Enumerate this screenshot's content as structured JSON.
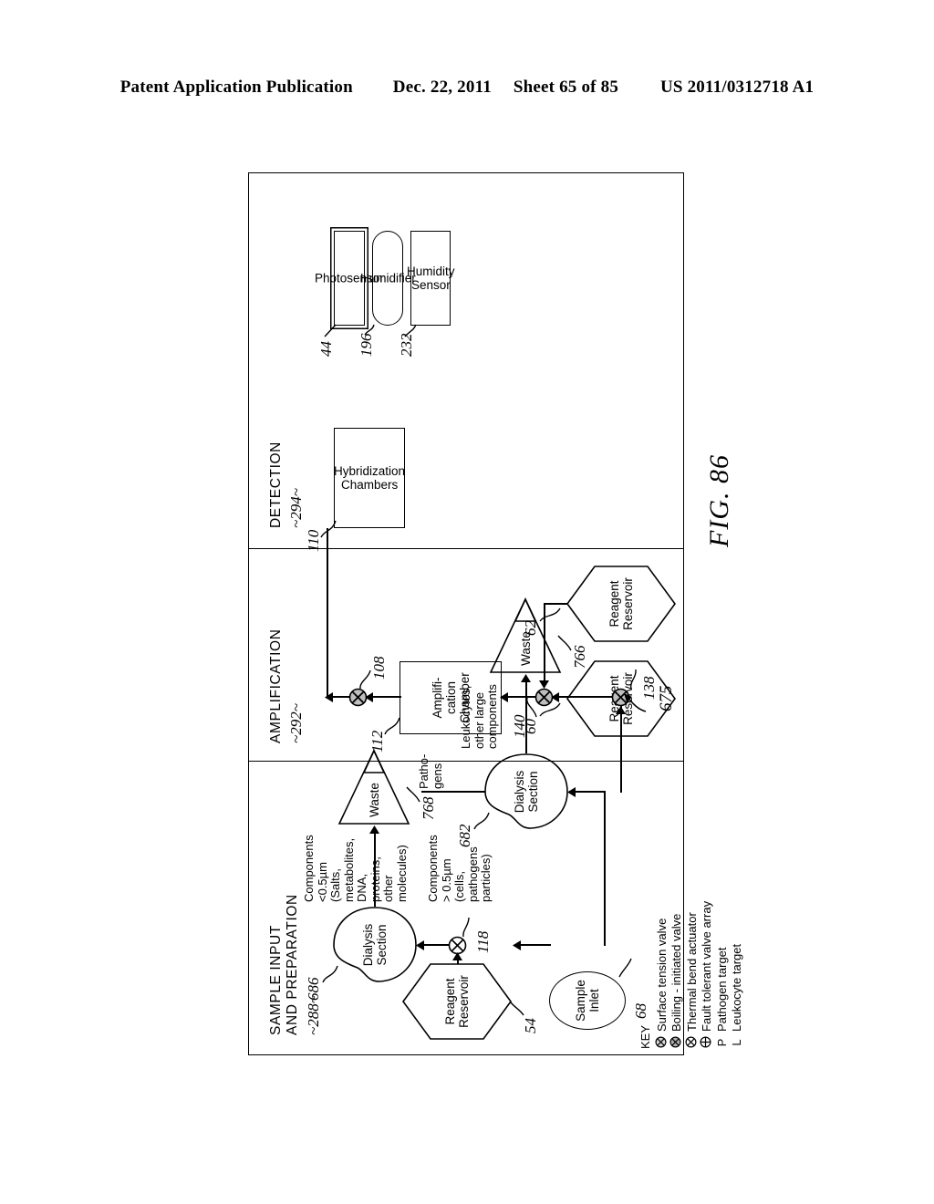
{
  "header": {
    "publication": "Patent Application Publication",
    "date": "Dec. 22, 2011",
    "sheet": "Sheet 65 of 85",
    "patent_number": "US 2011/0312718 A1"
  },
  "figure": {
    "label": "FIG. 86",
    "overall_ref": "675"
  },
  "sections": [
    {
      "title": "SAMPLE INPUT\nAND PREPARATION",
      "ref": "~288~"
    },
    {
      "title": "AMPLIFICATION",
      "ref": "~292~"
    },
    {
      "title": "DETECTION",
      "ref": "~294~"
    }
  ],
  "nodes": {
    "sample_inlet": {
      "label": "Sample\nInlet",
      "ref": "68"
    },
    "reagent_reservoir_54": {
      "label": "Reagent\nReservoir",
      "ref": "54"
    },
    "dialysis_686": {
      "label": "Dialysis\nSection",
      "ref": "686"
    },
    "dialysis_682": {
      "label": "Dialysis\nSection",
      "ref": "682"
    },
    "waste_768": {
      "label": "Waste",
      "ref": "768"
    },
    "waste_766": {
      "label": "Waste",
      "ref": "766"
    },
    "reagent_reservoir_60": {
      "label": "Reagent\nReservoir",
      "ref": "60"
    },
    "reagent_reservoir_62": {
      "label": "Reagent\nReservoir",
      "ref": "62"
    },
    "amplification_chamber": {
      "label": "Amplifi-\ncation\nChamber",
      "ref": "112"
    },
    "hybridization_chambers": {
      "label": "Hybridization\nChambers",
      "ref": "110"
    },
    "photosensor": {
      "label": "Photosensor",
      "ref": "44"
    },
    "humidifier": {
      "label": "Humidifier",
      "ref": "196"
    },
    "humidity_sensor": {
      "label": "Humidity\nSensor",
      "ref": "232"
    }
  },
  "valves": {
    "v118": {
      "ref": "118",
      "type": "surface-tension-valve"
    },
    "v138": {
      "ref": "138",
      "type": "boiling-initiated-valve"
    },
    "v140": {
      "ref": "140",
      "type": "boiling-initiated-valve"
    },
    "v108": {
      "ref": "108",
      "type": "boiling-initiated-valve"
    }
  },
  "flow_notes": {
    "large_components": "Components > 0.5µm\n(cells, pathogens\nparticles)",
    "small_components": "Components <0.5µm\n(Salts, metabolites, DNA,\nproteins, other molecules)",
    "pathogens": "Patho-\ngens",
    "leukocytes": "Leukocytes,\nother large\ncomponents"
  },
  "key": {
    "title": "KEY",
    "entries": [
      {
        "symbol": "circle-x-hatched",
        "symbol_text": "",
        "label": "Surface tension valve"
      },
      {
        "symbol": "circle-x-filled",
        "symbol_text": "",
        "label": "Boiling - initiated valve"
      },
      {
        "symbol": "circle-x-open",
        "symbol_text": "",
        "label": "Thermal bend actuator"
      },
      {
        "symbol": "circle-plus",
        "symbol_text": "",
        "label": "Fault tolerant valve array"
      },
      {
        "symbol": "letter",
        "symbol_text": "P",
        "label": "Pathogen target"
      },
      {
        "symbol": "letter",
        "symbol_text": "L",
        "label": "Leukocyte target"
      }
    ]
  },
  "colors": {
    "ink": "#000000",
    "paper": "#ffffff"
  }
}
